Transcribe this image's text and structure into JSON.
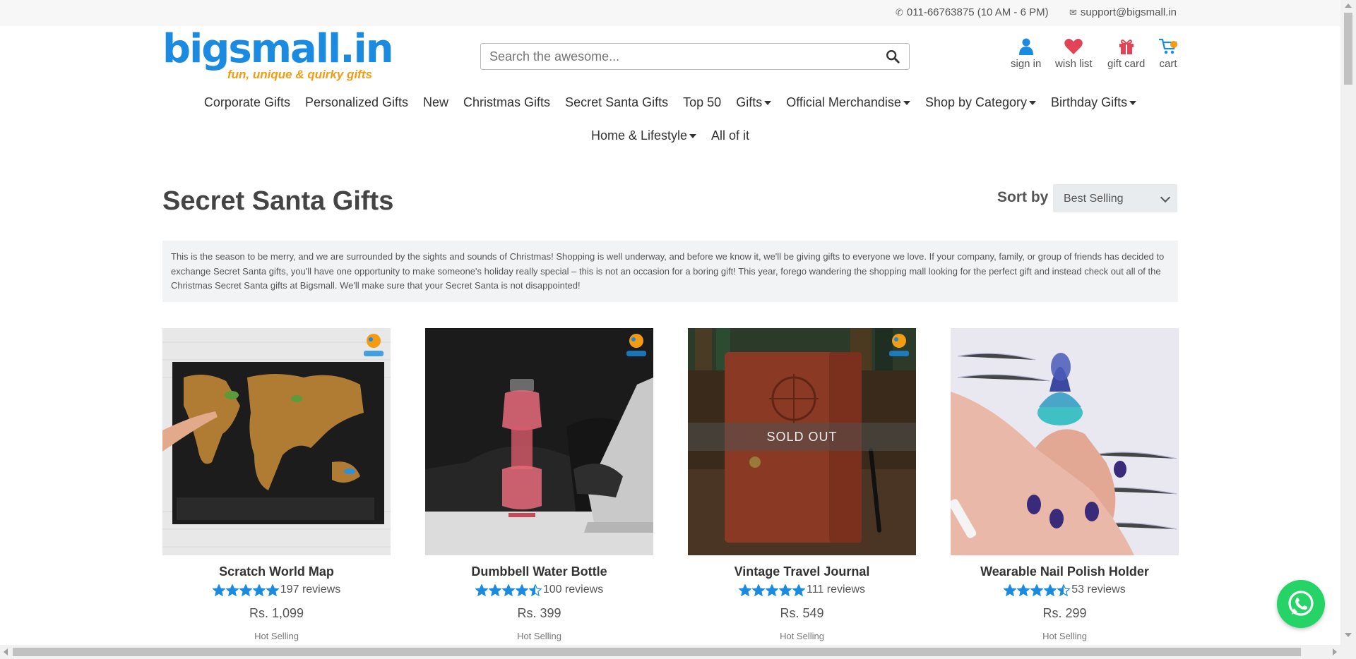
{
  "topbar": {
    "phone": "011-66763875 (10 AM - 6 PM)",
    "email": "support@bigsmall.in"
  },
  "header": {
    "logo_text": "bigsmall.in",
    "logo_tagline": "fun, unique & quirky gifts",
    "search_placeholder": "Search the awesome...",
    "icons": [
      {
        "label": "sign in",
        "icon": "user-icon"
      },
      {
        "label": "wish list",
        "icon": "heart-icon"
      },
      {
        "label": "gift card",
        "icon": "gift-icon"
      },
      {
        "label": "cart",
        "icon": "cart-icon"
      }
    ]
  },
  "nav": {
    "row1": [
      {
        "label": "Corporate Gifts",
        "dropdown": false
      },
      {
        "label": "Personalized Gifts",
        "dropdown": false
      },
      {
        "label": "New",
        "dropdown": false
      },
      {
        "label": "Christmas Gifts",
        "dropdown": false
      },
      {
        "label": "Secret Santa Gifts",
        "dropdown": false
      },
      {
        "label": "Top 50",
        "dropdown": false
      },
      {
        "label": "Gifts",
        "dropdown": true
      },
      {
        "label": "Official Merchandise",
        "dropdown": true
      },
      {
        "label": "Shop by Category",
        "dropdown": true
      },
      {
        "label": "Birthday Gifts",
        "dropdown": true
      }
    ],
    "row2": [
      {
        "label": "Home & Lifestyle",
        "dropdown": true
      },
      {
        "label": "All of it",
        "dropdown": false
      }
    ]
  },
  "page": {
    "title": "Secret Santa Gifts",
    "sort_label": "Sort by",
    "sort_value": "Best Selling",
    "description": "This is the season to be merry, and we are surrounded by the sights and sounds of Christmas! Shopping is well underway, and before we know it, we'll be giving gifts to everyone we love. If your company, family, or group of friends has decided to exchange Secret Santa gifts, you'll have one opportunity to make someone's holiday really special – this is not an occasion for a boring gift! This year, forego wandering the shopping mall looking for the perfect gift and instead check out all of the Christmas Secret Santa gifts at Bigsmall. We'll make sure that your Secret Santa is not disappointed!"
  },
  "products": [
    {
      "name": "Scratch World Map",
      "rating": 5,
      "reviews": "197 reviews",
      "price": "Rs. 1,099",
      "sold_out": false,
      "hot": "Hot Selling"
    },
    {
      "name": "Dumbbell Water Bottle",
      "rating": 4.5,
      "reviews": "100 reviews",
      "price": "Rs. 399",
      "sold_out": false,
      "hot": "Hot Selling"
    },
    {
      "name": "Vintage Travel Journal",
      "rating": 5,
      "reviews": "111 reviews",
      "price": "Rs. 549",
      "sold_out": true,
      "sold_out_label": "SOLD OUT",
      "hot": "Hot Selling"
    },
    {
      "name": "Wearable Nail Polish Holder",
      "rating": 4.5,
      "reviews": "53 reviews",
      "price": "Rs. 299",
      "sold_out": false,
      "hot": "Hot Selling"
    }
  ],
  "colors": {
    "brand_blue": "#1a8be0",
    "brand_orange": "#f39c12",
    "star_blue": "#1a8be0",
    "heart_red": "#e04456",
    "whatsapp_green": "#25d366"
  }
}
